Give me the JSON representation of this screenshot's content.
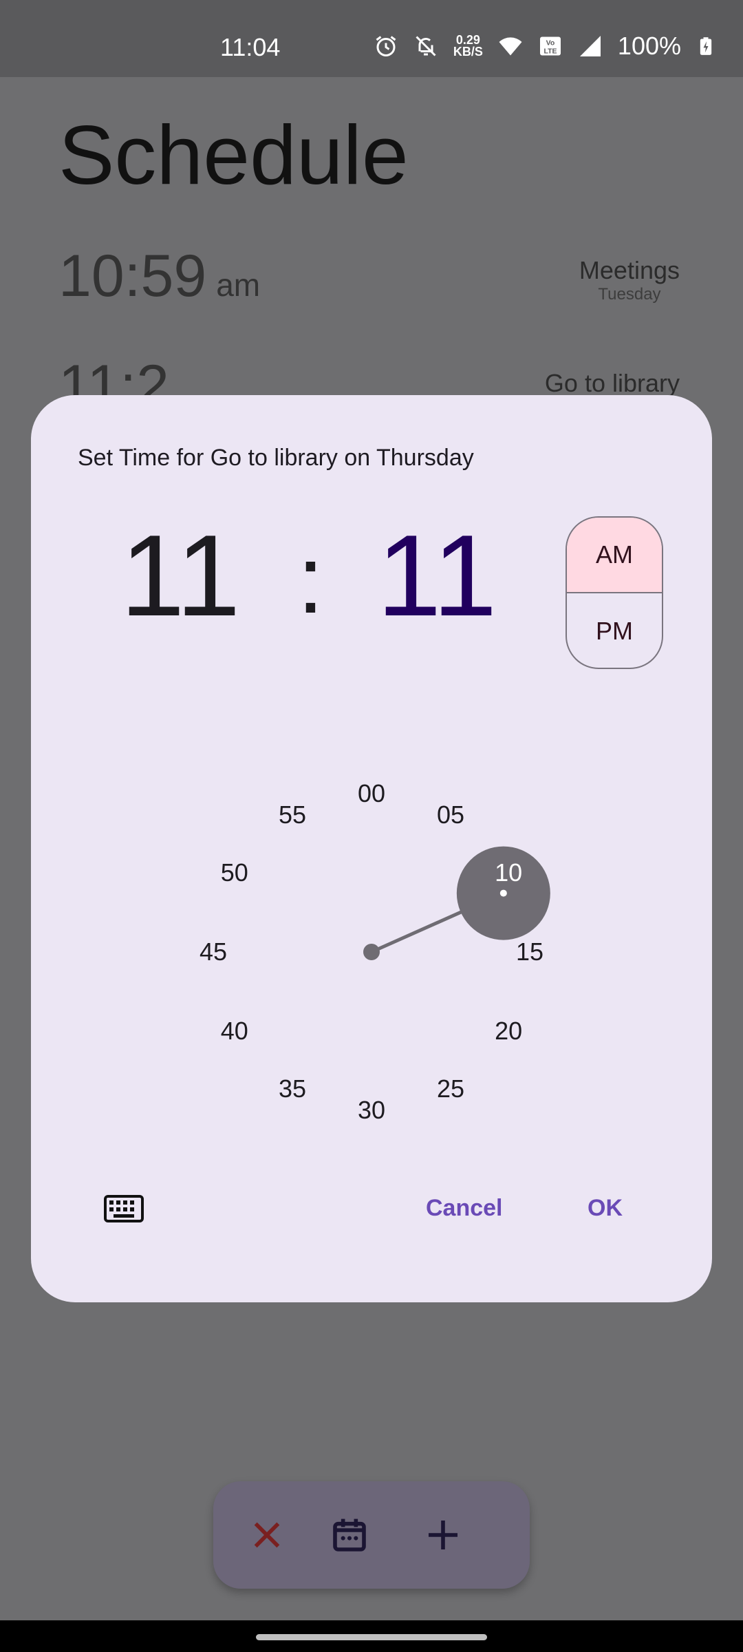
{
  "status": {
    "time": "11:04",
    "netspeed_value": "0.29",
    "netspeed_unit": "KB/S",
    "battery": "100%"
  },
  "page": {
    "title": "Schedule"
  },
  "schedule": [
    {
      "time": "10:59",
      "ampm": "am",
      "name": "Meetings",
      "day": "Tuesday"
    },
    {
      "time": "11:2",
      "name": "Go to library"
    }
  ],
  "dialog": {
    "title": "Set Time for Go to library on Thursday",
    "hour": "11",
    "separator": ":",
    "minute": "11",
    "am_label": "AM",
    "pm_label": "PM",
    "selected_period": "AM",
    "dial_numbers": [
      "00",
      "05",
      "10",
      "15",
      "20",
      "25",
      "30",
      "35",
      "40",
      "45",
      "50",
      "55"
    ],
    "selected_minute": 11,
    "cancel_label": "Cancel",
    "ok_label": "OK"
  },
  "bottom_bar": {
    "icons": [
      "close-icon",
      "calendar-icon",
      "add-icon"
    ]
  },
  "colors": {
    "scrim": "#6e6e70",
    "dialog_bg": "#ece6f4",
    "accent": "#6a4ab6",
    "am_selected": "#ffd9e2",
    "dial_selector": "#6f6c73"
  }
}
